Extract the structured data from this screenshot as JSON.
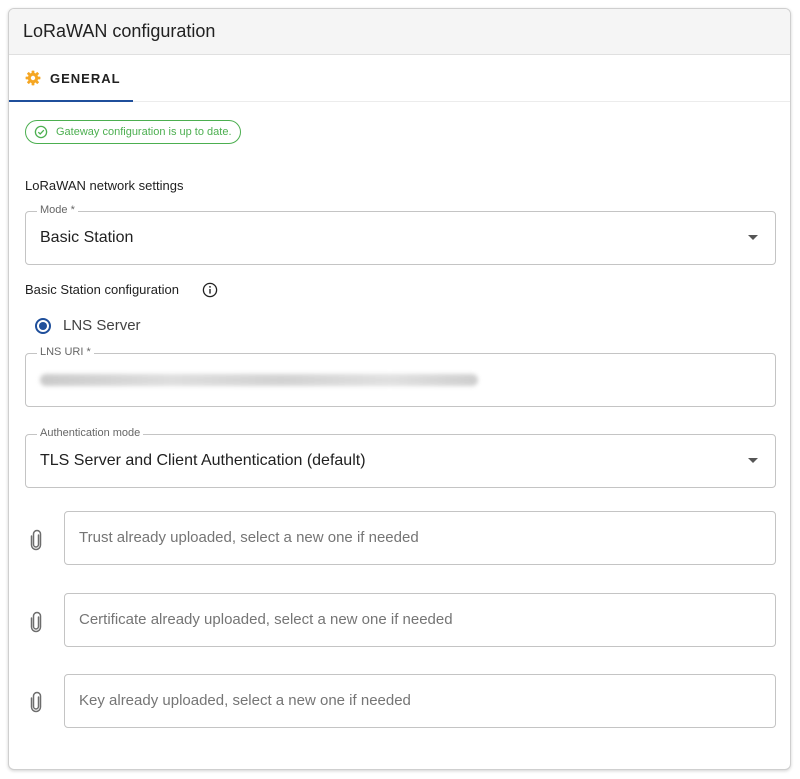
{
  "header": {
    "title": "LoRaWAN configuration"
  },
  "tabs": [
    {
      "label": "GENERAL",
      "icon": "gear-icon",
      "active": true
    }
  ],
  "status": {
    "text": "Gateway configuration is up to date.",
    "color": "#4caf50",
    "icon": "check-circle-icon"
  },
  "network": {
    "section_label": "LoRaWAN network settings",
    "mode": {
      "label": "Mode *",
      "value": "Basic Station"
    }
  },
  "basic_station": {
    "section_label": "Basic Station configuration",
    "radio": {
      "label": "LNS Server",
      "selected": true
    },
    "lns_uri": {
      "label": "LNS URI *"
    },
    "auth_mode": {
      "label": "Authentication mode",
      "value": "TLS Server and Client Authentication (default)"
    },
    "files": [
      {
        "placeholder": "Trust already uploaded, select a new one if needed",
        "icon": "paperclip-icon"
      },
      {
        "placeholder": "Certificate already uploaded, select a new one if needed",
        "icon": "paperclip-icon"
      },
      {
        "placeholder": "Key already uploaded, select a new one if needed",
        "icon": "paperclip-icon"
      }
    ]
  },
  "colors": {
    "accent": "#1f4f9b",
    "tab_icon": "#f5a623",
    "success": "#4caf50"
  }
}
